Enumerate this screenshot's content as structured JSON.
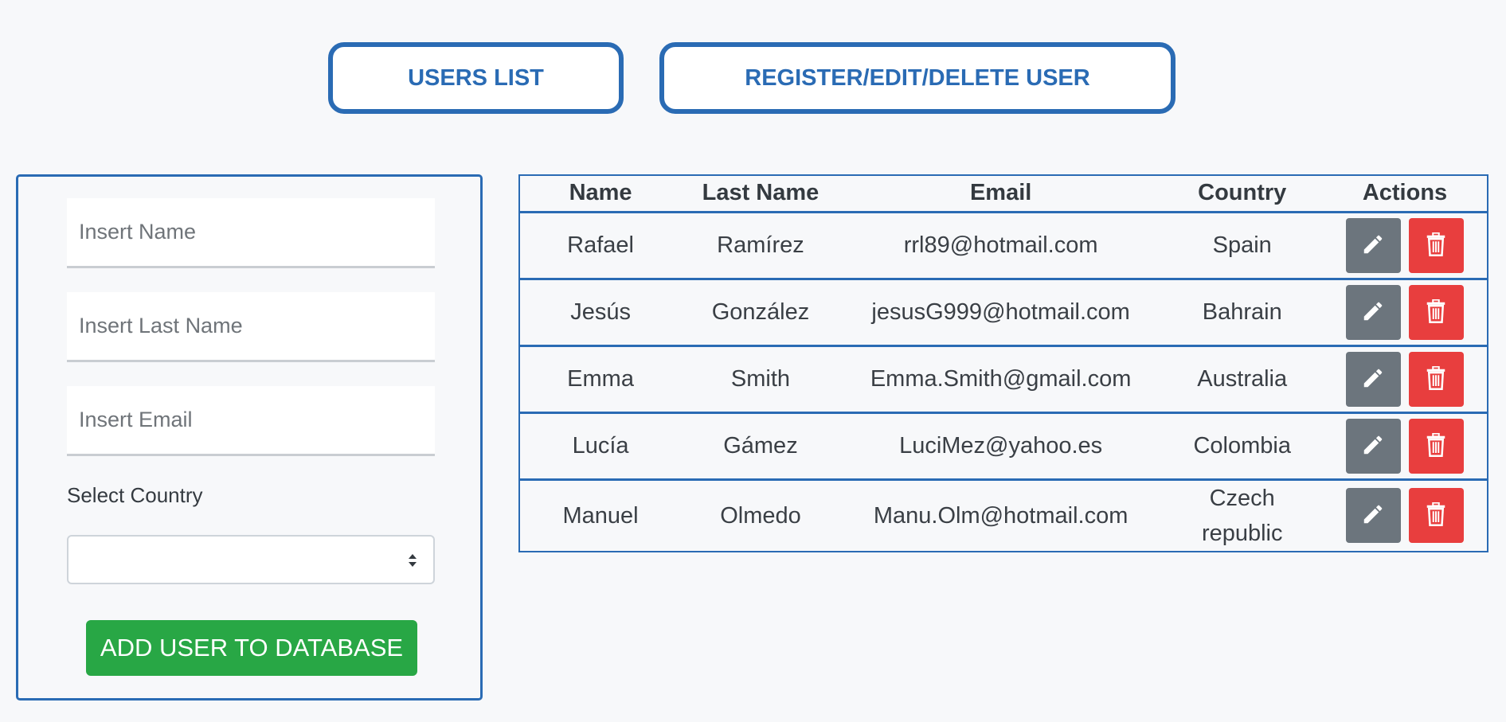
{
  "nav": {
    "users_list_label": "USERS LIST",
    "register_label": "REGISTER/EDIT/DELETE USER"
  },
  "form": {
    "name_placeholder": "Insert Name",
    "lastname_placeholder": "Insert Last Name",
    "email_placeholder": "Insert Email",
    "country_label": "Select Country",
    "country_value": "",
    "submit_label": "ADD USER TO DATABASE"
  },
  "table": {
    "headers": [
      "Name",
      "Last Name",
      "Email",
      "Country",
      "Actions"
    ],
    "rows": [
      {
        "name": "Rafael",
        "last_name": "Ramírez",
        "email": "rrl89@hotmail.com",
        "country": "Spain"
      },
      {
        "name": "Jesús",
        "last_name": "González",
        "email": "jesusG999@hotmail.com",
        "country": "Bahrain"
      },
      {
        "name": "Emma",
        "last_name": "Smith",
        "email": "Emma.Smith@gmail.com",
        "country": "Australia"
      },
      {
        "name": "Lucía",
        "last_name": "Gámez",
        "email": "LuciMez@yahoo.es",
        "country": "Colombia"
      },
      {
        "name": "Manuel",
        "last_name": "Olmedo",
        "email": "Manu.Olm@hotmail.com",
        "country": "Czech republic"
      }
    ],
    "edit_icon": "pencil-icon",
    "delete_icon": "trash-icon"
  },
  "colors": {
    "accent": "#2a6bb4",
    "success": "#28a745",
    "edit": "#6c757d",
    "danger": "#e83e3e",
    "background": "#f7f8fa"
  }
}
